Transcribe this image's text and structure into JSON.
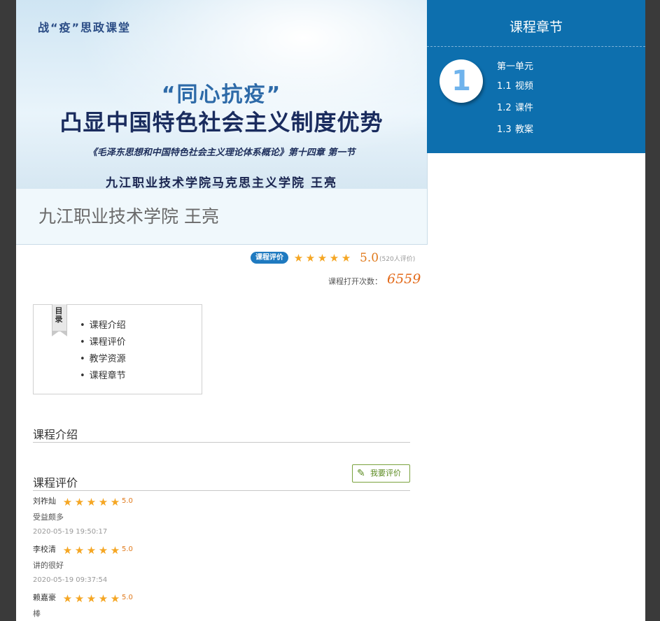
{
  "banner": {
    "tag": "战“疫”思政课堂",
    "slogan": "“同心抗疫”",
    "headline": "凸显中国特色社会主义制度优势",
    "subline": "《毛泽东思想和中国特色社会主义理论体系概论》第十四章 第一节",
    "author_line": "九江职业技术学院马克思主义学院 王亮",
    "overlay_text": "九江职业技术学院 王亮"
  },
  "rating": {
    "badge": "课程评价",
    "stars": 5,
    "score": "5.0",
    "count_text": "(520人评价)"
  },
  "open_count": {
    "label": "课程打开次数：",
    "value": "6559"
  },
  "toc": {
    "flag": "目录",
    "items": [
      "课程介绍",
      "课程评价",
      "教学资源",
      "课程章节"
    ]
  },
  "sections": {
    "intro_title": "课程介绍",
    "review_title": "课程评价",
    "review_button": "我要评价"
  },
  "reviews": [
    {
      "name": "刘祚灿",
      "stars": 5,
      "score": "5.0",
      "comment": "受益颇多",
      "time": "2020-05-19 19:50:17"
    },
    {
      "name": "李校清",
      "stars": 5,
      "score": "5.0",
      "comment": "讲的很好",
      "time": "2020-05-19 09:37:54"
    },
    {
      "name": "赖嘉豪",
      "stars": 5,
      "score": "5.0",
      "comment": "棒",
      "time": ""
    }
  ],
  "chapter": {
    "title": "课程章节",
    "unit_number": "1",
    "unit_name": "第一单元",
    "items": [
      {
        "num": "1.1",
        "label": "视频"
      },
      {
        "num": "1.2",
        "label": "课件"
      },
      {
        "num": "1.3",
        "label": "教案"
      }
    ]
  },
  "colors": {
    "panel_blue": "#0d6fae",
    "star": "#f5a623",
    "score": "#e07a1c",
    "badge": "#1f7ac0",
    "button_green": "#7aa23e"
  }
}
